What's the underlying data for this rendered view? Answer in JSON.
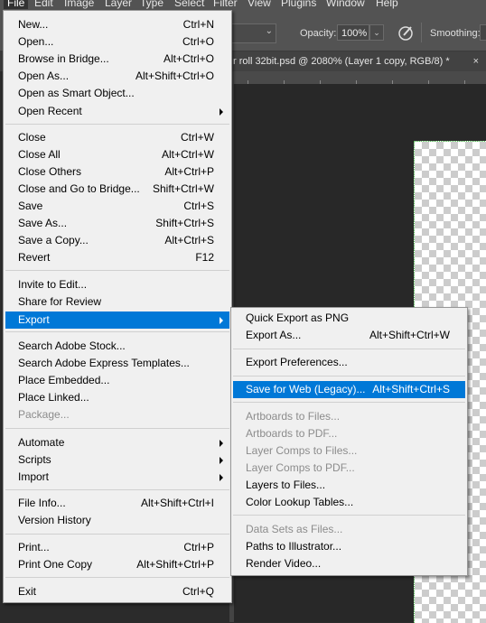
{
  "menubar": {
    "items": [
      "File",
      "Edit",
      "Image",
      "Layer",
      "Type",
      "Select",
      "Filter",
      "View",
      "Plugins",
      "Window",
      "Help"
    ]
  },
  "options": {
    "opacity_label": "Opacity:",
    "opacity_value": "100%",
    "smoothing_label": "Smoothing:"
  },
  "document_tab": {
    "title": "r roll 32bit.psd @ 2080% (Layer 1 copy, RGB/8) *",
    "close": "×"
  },
  "file_menu": {
    "items": [
      {
        "label": "New...",
        "shortcut": "Ctrl+N"
      },
      {
        "label": "Open...",
        "shortcut": "Ctrl+O"
      },
      {
        "label": "Browse in Bridge...",
        "shortcut": "Alt+Ctrl+O"
      },
      {
        "label": "Open As...",
        "shortcut": "Alt+Shift+Ctrl+O"
      },
      {
        "label": "Open as Smart Object...",
        "shortcut": ""
      },
      {
        "label": "Open Recent",
        "shortcut": ""
      },
      {
        "label": "Close",
        "shortcut": "Ctrl+W"
      },
      {
        "label": "Close All",
        "shortcut": "Alt+Ctrl+W"
      },
      {
        "label": "Close Others",
        "shortcut": "Alt+Ctrl+P"
      },
      {
        "label": "Close and Go to Bridge...",
        "shortcut": "Shift+Ctrl+W"
      },
      {
        "label": "Save",
        "shortcut": "Ctrl+S"
      },
      {
        "label": "Save As...",
        "shortcut": "Shift+Ctrl+S"
      },
      {
        "label": "Save a Copy...",
        "shortcut": "Alt+Ctrl+S"
      },
      {
        "label": "Revert",
        "shortcut": "F12"
      },
      {
        "label": "Invite to Edit...",
        "shortcut": ""
      },
      {
        "label": "Share for Review",
        "shortcut": ""
      },
      {
        "label": "Export",
        "shortcut": ""
      },
      {
        "label": "Search Adobe Stock...",
        "shortcut": ""
      },
      {
        "label": "Search Adobe Express Templates...",
        "shortcut": ""
      },
      {
        "label": "Place Embedded...",
        "shortcut": ""
      },
      {
        "label": "Place Linked...",
        "shortcut": ""
      },
      {
        "label": "Package...",
        "shortcut": ""
      },
      {
        "label": "Automate",
        "shortcut": ""
      },
      {
        "label": "Scripts",
        "shortcut": ""
      },
      {
        "label": "Import",
        "shortcut": ""
      },
      {
        "label": "File Info...",
        "shortcut": "Alt+Shift+Ctrl+I"
      },
      {
        "label": "Version History",
        "shortcut": ""
      },
      {
        "label": "Print...",
        "shortcut": "Ctrl+P"
      },
      {
        "label": "Print One Copy",
        "shortcut": "Alt+Shift+Ctrl+P"
      },
      {
        "label": "Exit",
        "shortcut": "Ctrl+Q"
      }
    ]
  },
  "export_menu": {
    "items": [
      {
        "label": "Quick Export as PNG",
        "shortcut": ""
      },
      {
        "label": "Export As...",
        "shortcut": "Alt+Shift+Ctrl+W"
      },
      {
        "label": "Export Preferences...",
        "shortcut": ""
      },
      {
        "label": "Save for Web (Legacy)...",
        "shortcut": "Alt+Shift+Ctrl+S"
      },
      {
        "label": "Artboards to Files...",
        "shortcut": ""
      },
      {
        "label": "Artboards to PDF...",
        "shortcut": ""
      },
      {
        "label": "Layer Comps to Files...",
        "shortcut": ""
      },
      {
        "label": "Layer Comps to PDF...",
        "shortcut": ""
      },
      {
        "label": "Layers to Files...",
        "shortcut": ""
      },
      {
        "label": "Color Lookup Tables...",
        "shortcut": ""
      },
      {
        "label": "Data Sets as Files...",
        "shortcut": ""
      },
      {
        "label": "Paths to Illustrator...",
        "shortcut": ""
      },
      {
        "label": "Render Video...",
        "shortcut": ""
      }
    ]
  },
  "colors": {
    "highlight": "#0078d7",
    "menu_bg": "#f0f0f0",
    "canvas_guide": "#49c14a"
  }
}
